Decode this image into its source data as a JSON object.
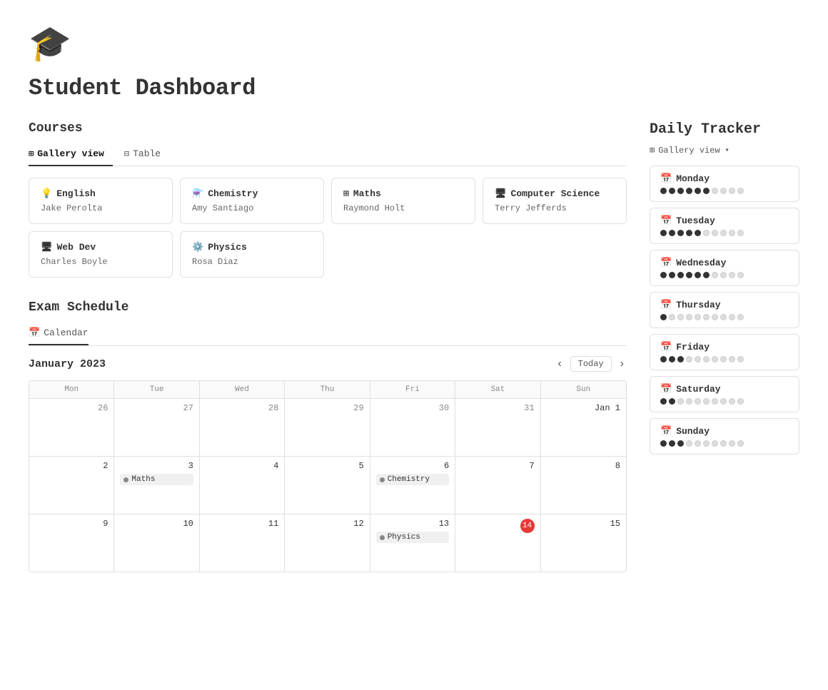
{
  "app": {
    "logo_icon": "🎓",
    "title": "Student Dashboard"
  },
  "courses_section": {
    "title": "Courses",
    "tabs": [
      {
        "id": "gallery",
        "label": "Gallery view",
        "icon": "⊞",
        "active": true
      },
      {
        "id": "table",
        "label": "Table",
        "icon": "⊟",
        "active": false
      }
    ],
    "cards": [
      {
        "icon": "💡",
        "name": "English",
        "teacher": "Jake Perolta"
      },
      {
        "icon": "⚗️",
        "name": "Chemistry",
        "teacher": "Amy Santiago"
      },
      {
        "icon": "⊞",
        "name": "Maths",
        "teacher": "Raymond Holt"
      },
      {
        "icon": "🖥",
        "name": "Computer Science",
        "teacher": "Terry Jefferds"
      },
      {
        "icon": "🖥",
        "name": "Web Dev",
        "teacher": "Charles Boyle"
      },
      {
        "icon": "⚙️",
        "name": "Physics",
        "teacher": "Rosa Diaz"
      }
    ]
  },
  "exam_section": {
    "title": "Exam Schedule",
    "tab_label": "Calendar",
    "tab_icon": "📅",
    "month": "January 2023",
    "today_label": "Today",
    "day_labels": [
      "Mon",
      "Tue",
      "Wed",
      "Thu",
      "Fri",
      "Sat",
      "Sun"
    ],
    "weeks": [
      {
        "days": [
          {
            "date": "26",
            "in_month": false,
            "events": []
          },
          {
            "date": "27",
            "in_month": false,
            "events": []
          },
          {
            "date": "28",
            "in_month": false,
            "events": []
          },
          {
            "date": "29",
            "in_month": false,
            "events": []
          },
          {
            "date": "30",
            "in_month": false,
            "events": []
          },
          {
            "date": "31",
            "in_month": false,
            "events": []
          },
          {
            "date": "Jan 1",
            "in_month": true,
            "events": []
          }
        ]
      },
      {
        "days": [
          {
            "date": "2",
            "in_month": true,
            "events": []
          },
          {
            "date": "3",
            "in_month": true,
            "events": [
              {
                "label": "Maths",
                "color": "#aaa",
                "dot_color": "#888"
              }
            ]
          },
          {
            "date": "4",
            "in_month": true,
            "events": []
          },
          {
            "date": "5",
            "in_month": true,
            "events": []
          },
          {
            "date": "6",
            "in_month": true,
            "events": [
              {
                "label": "Chemistry",
                "color": "#f0f0f0",
                "dot_color": "#888"
              }
            ]
          },
          {
            "date": "7",
            "in_month": true,
            "events": []
          },
          {
            "date": "8",
            "in_month": true,
            "events": []
          }
        ]
      },
      {
        "days": [
          {
            "date": "9",
            "in_month": true,
            "events": []
          },
          {
            "date": "10",
            "in_month": true,
            "events": []
          },
          {
            "date": "11",
            "in_month": true,
            "events": []
          },
          {
            "date": "12",
            "in_month": true,
            "events": []
          },
          {
            "date": "13",
            "in_month": true,
            "events": [
              {
                "label": "Physics",
                "color": "#f0f0f0",
                "dot_color": "#888"
              }
            ]
          },
          {
            "date": "14",
            "in_month": true,
            "events": [],
            "today": true
          },
          {
            "date": "15",
            "in_month": true,
            "events": []
          }
        ]
      }
    ]
  },
  "daily_tracker": {
    "title": "Daily Tracker",
    "view_label": "Gallery view",
    "view_icon": "⊞",
    "days": [
      {
        "name": "Monday",
        "filled": 6,
        "total": 10
      },
      {
        "name": "Tuesday",
        "filled": 5,
        "total": 10
      },
      {
        "name": "Wednesday",
        "filled": 6,
        "total": 10
      },
      {
        "name": "Thursday",
        "filled": 1,
        "total": 10
      },
      {
        "name": "Friday",
        "filled": 3,
        "total": 10
      },
      {
        "name": "Saturday",
        "filled": 2,
        "total": 10
      },
      {
        "name": "Sunday",
        "filled": 3,
        "total": 10
      }
    ]
  }
}
